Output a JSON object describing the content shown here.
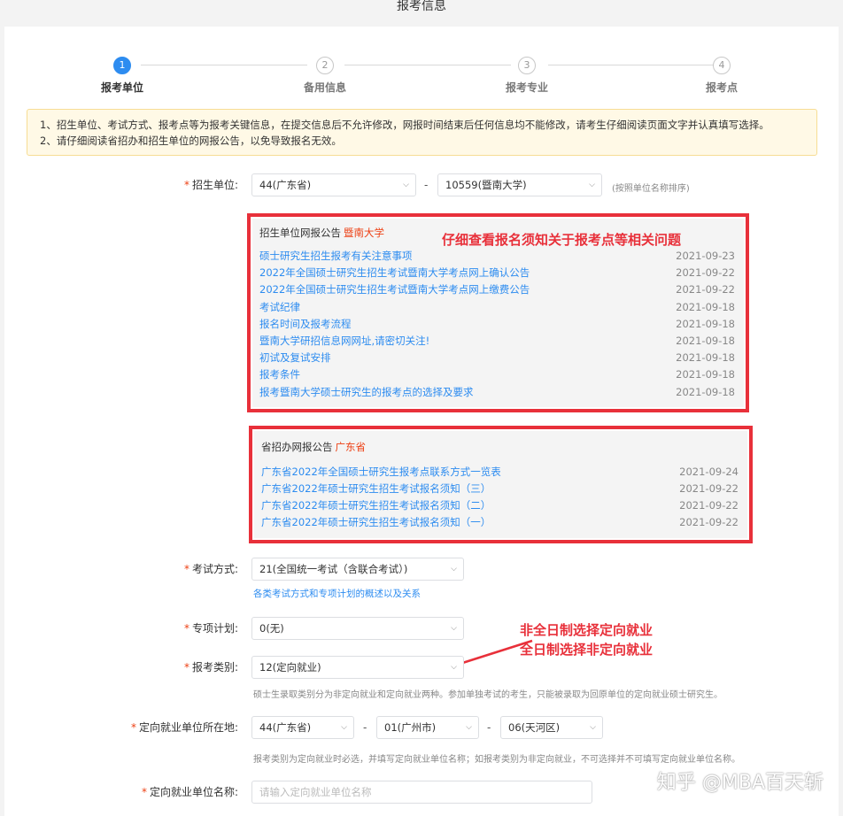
{
  "header": {
    "title": "报考信息"
  },
  "steps": [
    {
      "number": "1",
      "label": "报考单位",
      "active": true
    },
    {
      "number": "2",
      "label": "备用信息",
      "active": false
    },
    {
      "number": "3",
      "label": "报考专业",
      "active": false
    },
    {
      "number": "4",
      "label": "报考点",
      "active": false
    }
  ],
  "notice": {
    "line1": "1、招生单位、考试方式、报考点等为报考关键信息，在提交信息后不允许修改，网报时间结束后任何信息均不能修改，请考生仔细阅读页面文字并认真填写选择。",
    "line2": "2、请仔细阅读省招办和招生单位的网报公告，以免导致报名无效。"
  },
  "form": {
    "unit": {
      "label": "招生单位:",
      "province": "44(广东省)",
      "school": "10559(暨南大学)",
      "hint": "(按照单位名称排序)"
    },
    "exam_method": {
      "label": "考试方式:",
      "value": "21(全国统一考试（含联合考试）)",
      "link": "各类考试方式和专项计划的概述以及关系"
    },
    "special_plan": {
      "label": "专项计划:",
      "value": "0(无)"
    },
    "category": {
      "label": "报考类别:",
      "value": "12(定向就业)",
      "hint": "硕士生录取类别分为非定向就业和定向就业两种。参加单独考试的考生，只能被录取为回原单位的定向就业硕士研究生。"
    },
    "employer_location": {
      "label": "定向就业单位所在地:",
      "province": "44(广东省)",
      "city": "01(广州市)",
      "district": "06(天河区)",
      "hint": "报考类别为定向就业时必选，并填写定向就业单位名称；如报考类别为非定向就业，不可选择并不可填写定向就业单位名称。"
    },
    "employer_name": {
      "label": "定向就业单位名称:",
      "placeholder": "请输入定向就业单位名称"
    },
    "dash": "-"
  },
  "school_notices": {
    "title": "招生单位网报公告",
    "school_name": "暨南大学",
    "annotation": "仔细查看报名须知关于报考点等相关问题",
    "items": [
      {
        "title": "硕士研究生招生报考有关注意事项",
        "date": "2021-09-23"
      },
      {
        "title": "2022年全国硕士研究生招生考试暨南大学考点网上确认公告",
        "date": "2021-09-22"
      },
      {
        "title": "2022年全国硕士研究生招生考试暨南大学考点网上缴费公告",
        "date": "2021-09-22"
      },
      {
        "title": "考试纪律",
        "date": "2021-09-18"
      },
      {
        "title": "报名时间及报考流程",
        "date": "2021-09-18"
      },
      {
        "title": "暨南大学研招信息网网址,请密切关注!",
        "date": "2021-09-18"
      },
      {
        "title": "初试及复试安排",
        "date": "2021-09-18"
      },
      {
        "title": "报考条件",
        "date": "2021-09-18"
      },
      {
        "title": "报考暨南大学硕士研究生的报考点的选择及要求",
        "date": "2021-09-18"
      }
    ]
  },
  "province_notices": {
    "title": "省招办网报公告",
    "province_name": "广东省",
    "items": [
      {
        "title": "广东省2022年全国硕士研究生报考点联系方式一览表",
        "date": "2021-09-24"
      },
      {
        "title": "广东省2022年硕士研究生招生考试报名须知（三）",
        "date": "2021-09-22"
      },
      {
        "title": "广东省2022年硕士研究生招生考试报名须知（二）",
        "date": "2021-09-22"
      },
      {
        "title": "广东省2022年硕士研究生招生考试报名须知（一）",
        "date": "2021-09-22"
      }
    ]
  },
  "annotation_right": {
    "line1": "非全日制选择定向就业",
    "line2": "全日制选择非定向就业"
  },
  "watermark": "知乎 @MBA百天斩",
  "colors": {
    "accent": "#2d8cf0",
    "annotation": "#e8303a",
    "required": "#ed4014"
  }
}
